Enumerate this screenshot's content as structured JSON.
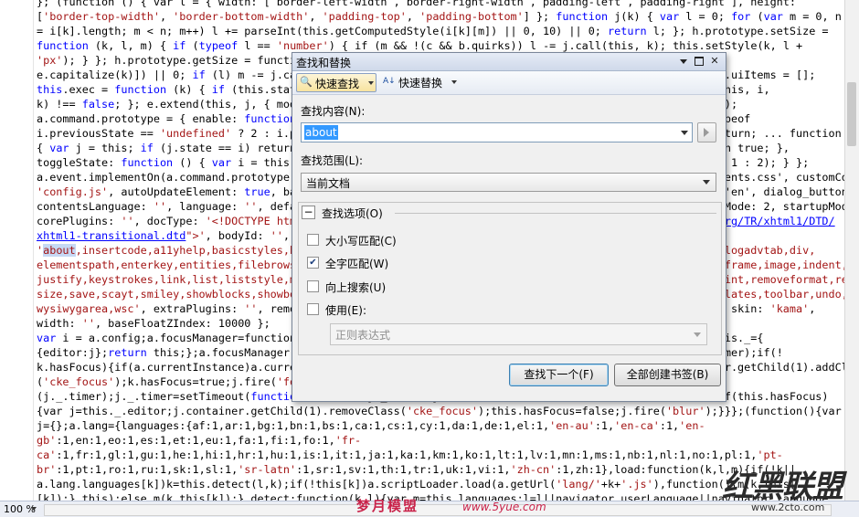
{
  "editor": {
    "lines": [
      {
        "segments": [
          {
            "t": "}; (function () { var l = { width: [ border-left-width , border-right-width , padding-left , padding-right ], height:"
          }
        ]
      },
      {
        "segments": [
          {
            "t": "[",
            "c": ""
          },
          {
            "t": "'border-top-width'",
            "c": "str"
          },
          {
            "t": ", "
          },
          {
            "t": "'border-bottom-width'",
            "c": "str"
          },
          {
            "t": ", "
          },
          {
            "t": "'padding-top'",
            "c": "str"
          },
          {
            "t": ", "
          },
          {
            "t": "'padding-bottom'",
            "c": "str"
          },
          {
            "t": "] }; "
          },
          {
            "t": "function",
            "c": "kw"
          },
          {
            "t": " j(k) { "
          },
          {
            "t": "var",
            "c": "kw"
          },
          {
            "t": " l = 0; "
          },
          {
            "t": "for",
            "c": "kw"
          },
          {
            "t": " ("
          },
          {
            "t": "var",
            "c": "kw"
          },
          {
            "t": " m = 0, n"
          }
        ]
      },
      {
        "segments": [
          {
            "t": "= i[k].length; m < n; m++) l += parseInt(this.getComputedStyle(i[k][m]) || 0, 10) || 0; "
          },
          {
            "t": "return",
            "c": "kw"
          },
          {
            "t": " l; }; h.prototype.setSize ="
          }
        ]
      },
      {
        "segments": [
          {
            "t": "function",
            "c": "kw"
          },
          {
            "t": " (k, l, m) { "
          },
          {
            "t": "if",
            "c": "kw"
          },
          {
            "t": " ("
          },
          {
            "t": "typeof",
            "c": "kw"
          },
          {
            "t": " l == "
          },
          {
            "t": "'number'",
            "c": "str"
          },
          {
            "t": ") { if (m && !(c && b.quirks)) l -= j.call(this, k); this.setStyle(k, l +"
          }
        ]
      },
      {
        "segments": [
          {
            "t": "'px'",
            "c": "str"
          },
          {
            "t": "); } }; h.prototype.getSize = function (k) { var l = Math.max(this.$['offset' + k], this.$['client' +"
          }
        ]
      },
      {
        "segments": [
          {
            "t": "e.capitalize(k)]) || 0; "
          },
          {
            "t": "if",
            "c": "kw"
          },
          {
            "t": " (l) m -= j.call(this, k); "
          },
          {
            "t": "return",
            "c": "kw"
          },
          {
            "t": " l; }; })(); a.command = function (i, j) { this.uiItems = [];"
          }
        ]
      },
      {
        "segments": [
          {
            "t": "this",
            "c": "kw"
          },
          {
            "t": ".exec = "
          },
          {
            "t": "function",
            "c": "kw"
          },
          {
            "t": " (k) { "
          },
          {
            "t": "if",
            "c": "kw"
          },
          {
            "t": " (this.state == 0 || !this.checkAllowed()) return false; return j.exec.call(this, i,"
          }
        ]
      },
      {
        "segments": [
          {
            "t": "k) !== "
          },
          {
            "t": "false",
            "c": "kw"
          },
          {
            "t": "; }; e.extend(this, j, { modes: { wysiwyg: 1 }, editorFocus: 1, state: 2 }); a.event.call(this);"
          }
        ]
      },
      {
        "segments": [
          {
            "t": "a.command.prototype = { enable: "
          },
          {
            "t": "function",
            "c": "kw"
          },
          {
            "t": " () { if (this.state == 0) this.setState(...); }, disable: ..., typeof"
          }
        ]
      },
      {
        "segments": [
          {
            "t": "i.previousState == "
          },
          {
            "t": "'undefined'",
            "c": "str"
          },
          {
            "t": " ? 2 : i.previousState); }, setState: function (i) { if (this.state == i) return; ... function (i)"
          }
        ]
      },
      {
        "segments": [
          {
            "t": "{ "
          },
          {
            "t": "var",
            "c": "kw"
          },
          {
            "t": " j = this; "
          },
          {
            "t": "if",
            "c": "kw"
          },
          {
            "t": " (j.state == i) return false; this.previousState = this.state; this.fire('state'); return true; },"
          }
        ]
      },
      {
        "segments": [
          {
            "t": "toggleState: "
          },
          {
            "t": "function",
            "c": "kw"
          },
          {
            "t": " () { "
          },
          {
            "t": "var",
            "c": "kw"
          },
          {
            "t": " i = this; if (this.state == 0) return; else this.setState(this.state == 2 ? 1 : 2); } };"
          }
        ]
      },
      {
        "segments": [
          {
            "t": "a.event.implementOn(a.command.prototype, "
          },
          {
            "t": "true",
            "c": "kw"
          },
          {
            "t": "); a.config = { baseHref: '', contentsCss: a.basePath + 'contents.css', customConfig:"
          }
        ]
      },
      {
        "segments": [
          {
            "t": "'config.js'",
            "c": "str"
          },
          {
            "t": ", autoUpdateElement: "
          },
          {
            "t": "true",
            "c": "kw"
          },
          {
            "t": ", baseFloatZIndex: 10000, bodyClass: '', bodyId: '', defaultLanguage: 'en', dialog_buttonsOrder: 'OS', contentsLangDirection: "
          },
          {
            "t": "'ui'",
            "c": "str"
          },
          {
            "t": ","
          }
        ]
      },
      {
        "segments": [
          {
            "t": "contentsLanguage: "
          },
          {
            "t": "''",
            "c": "str"
          },
          {
            "t": ", language: "
          },
          {
            "t": "''",
            "c": "str"
          },
          {
            "t": ", defaultLanguage: 'en', enterMode: 1, forceEnterMode: false, shiftEnterMode: 2, startupMode: 'wysiwyg', e: 2,"
          }
        ]
      },
      {
        "segments": [
          {
            "t": "corePlugins: "
          },
          {
            "t": "''",
            "c": "str"
          },
          {
            "t": ", docType: "
          },
          {
            "t": "'<!DOCTYPE html PUBLIC \"-//W3C//DTD XHTML 1.0 Transitional//EN\" \"",
            "c": "str"
          },
          {
            "t": "http://www.w3.org/TR/xhtml1/DTD/",
            "c": "lnk"
          }
        ]
      },
      {
        "segments": [
          {
            "t": "xhtml1-transitional.dtd",
            "c": "lnk"
          },
          {
            "t": "\">'",
            "c": "str"
          },
          {
            "t": ", bodyId: "
          },
          {
            "t": "''",
            "c": "str"
          },
          {
            "t": ", bodyClass: '', fullPage: false, height: 200, plugins:"
          }
        ]
      },
      {
        "segments": [
          {
            "t": "'",
            "c": "str"
          },
          {
            "t": "about",
            "c": "str hl"
          },
          {
            "t": ",insertcode,a11yhelp,basicstyles,blockquote,button,clipboard,colorbutton,colordialog,contextmenu,dialogadvtab,div,",
            "c": "str"
          }
        ]
      },
      {
        "segments": [
          {
            "t": "elementspath,enterkey,entities,filebrowser,find,flash,font,format,forms,horizontalrule,htmldataprocessor,iframe,image,indent,",
            "c": "str"
          }
        ]
      },
      {
        "segments": [
          {
            "t": "justify,keystrokes,link,list,liststyle,maximize,newpage,pagebreak,pastefromword,pastetext,popup,preview,print,removeformat,re",
            "c": "str"
          }
        ]
      },
      {
        "segments": [
          {
            "t": "size,save,scayt,smiley,showblocks,showborders,sourcearea,stylescombo,table,tabletools,specialchar,tab,templates,toolbar,undo,",
            "c": "str"
          }
        ]
      },
      {
        "segments": [
          {
            "t": "wysiwygarea,wsc'",
            "c": "str"
          },
          {
            "t": ", extraPlugins: "
          },
          {
            "t": "''",
            "c": "str"
          },
          {
            "t": ", removePlugins: '', protectedSource: [], tabIndex: 0, theme: 'default', skin: "
          },
          {
            "t": "'kama'",
            "c": "str"
          },
          {
            "t": ","
          }
        ]
      },
      {
        "segments": [
          {
            "t": "width: "
          },
          {
            "t": "''",
            "c": "str"
          },
          {
            "t": ", baseFloatZIndex: 10000 };"
          }
        ]
      },
      {
        "segments": [
          {
            "t": "var",
            "c": "kw"
          },
          {
            "t": " i = a.config;a.focusManager=function(j){if(j.focusManager)return j.focusManager;this.hasFocus=false;this._={"
          }
        ]
      },
      {
        "segments": [
          {
            "t": "{editor:j};"
          },
          {
            "t": "return",
            "c": "kw"
          },
          {
            "t": " this;};a.focusManager.prototype={focus:function(){if(this._.timer)clearTimeout(this._.timer);if(!"
          }
        ]
      },
      {
        "segments": [
          {
            "t": "k.hasFocus){if(a.currentInstance)a.currentInstance.focusManager.forceBlur();var j=this._.editor;j.container.getChild(1).addClass"
          }
        ]
      },
      {
        "segments": [
          {
            "t": "("
          },
          {
            "t": "'cke_focus'",
            "c": "str"
          },
          {
            "t": ");k.hasFocus=true;j.fire("
          },
          {
            "t": "'focus'",
            "c": "str"
          },
          {
            "t": ");}},blur:function(){var j=this;if(j._.timer)clearTimeout("
          }
        ]
      },
      {
        "segments": [
          {
            "t": "(j._.timer);j._.timer=setTimeout("
          },
          {
            "t": "function",
            "c": "kw"
          },
          {
            "t": "(){delete j._.timer;j.forceBlur();},100);},forceBlur:function(){if(this.hasFocus)"
          }
        ]
      },
      {
        "segments": [
          {
            "t": "{var j=this._.editor;j.container.getChild(1).removeClass("
          },
          {
            "t": "'cke_focus'",
            "c": "str"
          },
          {
            "t": ");this.hasFocus=false;j.fire("
          },
          {
            "t": "'blur'",
            "c": "str"
          },
          {
            "t": ");}}};(function(){var"
          }
        ]
      },
      {
        "segments": [
          {
            "t": "j={};a.lang={languages:{af:1,ar:1,bg:1,bn:1,bs:1,ca:1,cs:1,cy:1,da:1,de:1,el:1,"
          },
          {
            "t": "'en-au'",
            "c": "str"
          },
          {
            "t": ":1,"
          },
          {
            "t": "'en-ca'",
            "c": "str"
          },
          {
            "t": ":1,"
          },
          {
            "t": "'en-",
            "c": "str"
          }
        ]
      },
      {
        "segments": [
          {
            "t": "gb'",
            "c": "str"
          },
          {
            "t": ":1,en:1,eo:1,es:1,et:1,eu:1,fa:1,fi:1,fo:1,"
          },
          {
            "t": "'fr-",
            "c": "str"
          }
        ]
      },
      {
        "segments": [
          {
            "t": "ca'",
            "c": "str"
          },
          {
            "t": ":1,fr:1,gl:1,gu:1,he:1,hi:1,hr:1,hu:1,is:1,it:1,ja:1,ka:1,km:1,ko:1,lt:1,lv:1,mn:1,ms:1,nb:1,nl:1,no:1,pl:1,"
          },
          {
            "t": "'pt-",
            "c": "str"
          }
        ]
      },
      {
        "segments": [
          {
            "t": "br'",
            "c": "str"
          },
          {
            "t": ":1,pt:1,ro:1,ru:1,sk:1,sl:1,"
          },
          {
            "t": "'sr-latn'",
            "c": "str"
          },
          {
            "t": ":1,sr:1,sv:1,th:1,tr:1,uk:1,vi:1,"
          },
          {
            "t": "'zh-cn'",
            "c": "str"
          },
          {
            "t": ":1,zh:1},load:function(k,l,m){if(!k||"
          }
        ]
      },
      {
        "segments": [
          {
            "t": "a.lang.languages[k])k=this.detect(l,k);if(!this[k])a.scriptLoader.load(a.getUrl("
          },
          {
            "t": "'lang/'",
            "c": "str"
          },
          {
            "t": "+k+"
          },
          {
            "t": "'.js'",
            "c": "str"
          },
          {
            "t": "),function(){m(k,this["
          }
        ]
      },
      {
        "segments": [
          {
            "t": "[k]);},this);else m(k,this[k]);},detect:function(k,l){var m=this.languages;l=l||navigator.userLanguage||navigator.language;"
          }
        ]
      }
    ]
  },
  "statusbar": {
    "zoom": "100 %"
  },
  "dialog": {
    "title": "查找和替换",
    "title_buttons": {
      "menu": "menu",
      "restore": "restore",
      "close": "✕"
    },
    "toolbar": {
      "quick_find": {
        "icon": "find-icon",
        "label": "快速查找"
      },
      "quick_replace": {
        "icon": "replace-icon",
        "label": "快速替换"
      }
    },
    "find": {
      "label": "查找内容(N):",
      "value": "about"
    },
    "scope": {
      "label": "查找范围(L):",
      "value": "当前文档"
    },
    "options": {
      "label": "查找选项(O)",
      "collapse": "−",
      "items": [
        {
          "label": "大小写匹配(C)",
          "checked": false
        },
        {
          "label": "全字匹配(W)",
          "checked": true
        },
        {
          "label": "向上搜索(U)",
          "checked": false
        },
        {
          "label": "使用(E):",
          "checked": false
        }
      ],
      "regex": {
        "value": "正则表达式",
        "enabled": false
      }
    },
    "buttons": {
      "find_next": "查找下一个(F)",
      "bookmark_all": "全部创建书签(B)"
    }
  },
  "watermark": {
    "site1": "梦月模盟",
    "site2": "www.5yue.com",
    "brand": "红黑联盟",
    "url": "www.2cto.com"
  }
}
